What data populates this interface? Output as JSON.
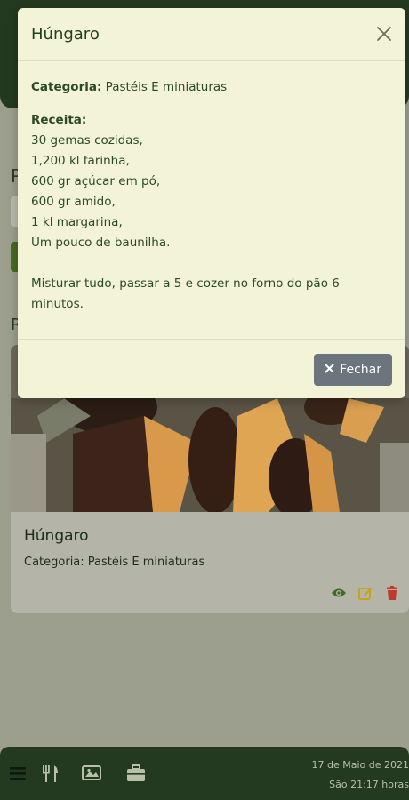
{
  "modal": {
    "title": "Húngaro",
    "category_label": "Categoria:",
    "category_value": "Pastéis E miniaturas",
    "recipe_label": "Receita:",
    "ingredients": [
      "30 gemas cozidas,",
      "1,200 kl farinha,",
      "600 gr açúcar em pó,",
      "600 gr amido,",
      "1 kl margarina,",
      "Um pouco de baunilha."
    ],
    "instructions_1": "Misturar tudo, passar a 5 e cozer no forno do pão 6",
    "instructions_2": "minutos.",
    "close_button_label": "Fechar",
    "close_icon": "x-icon"
  },
  "page": {
    "partial_heading_1": "P",
    "partial_heading_2": "R"
  },
  "card": {
    "title": "Húngaro",
    "category": "Categoria: Pastéis E miniaturas",
    "actions": [
      "eye-icon",
      "edit-icon",
      "trash-icon"
    ],
    "action_colors": {
      "view": "#3f6a25",
      "edit": "#c9a21c",
      "delete": "#c0392b"
    }
  },
  "footer": {
    "date": "17 de Maio de 2021",
    "time": "São 21:17 horas",
    "icons": [
      "hamburger-icon",
      "utensils-icon",
      "images-icon",
      "briefcase-icon"
    ]
  },
  "colors": {
    "primary_dark_green": "#243a20",
    "modal_bg": "#f3f3d8",
    "text_green": "#2a4a24",
    "button_grey": "#6c757d"
  }
}
